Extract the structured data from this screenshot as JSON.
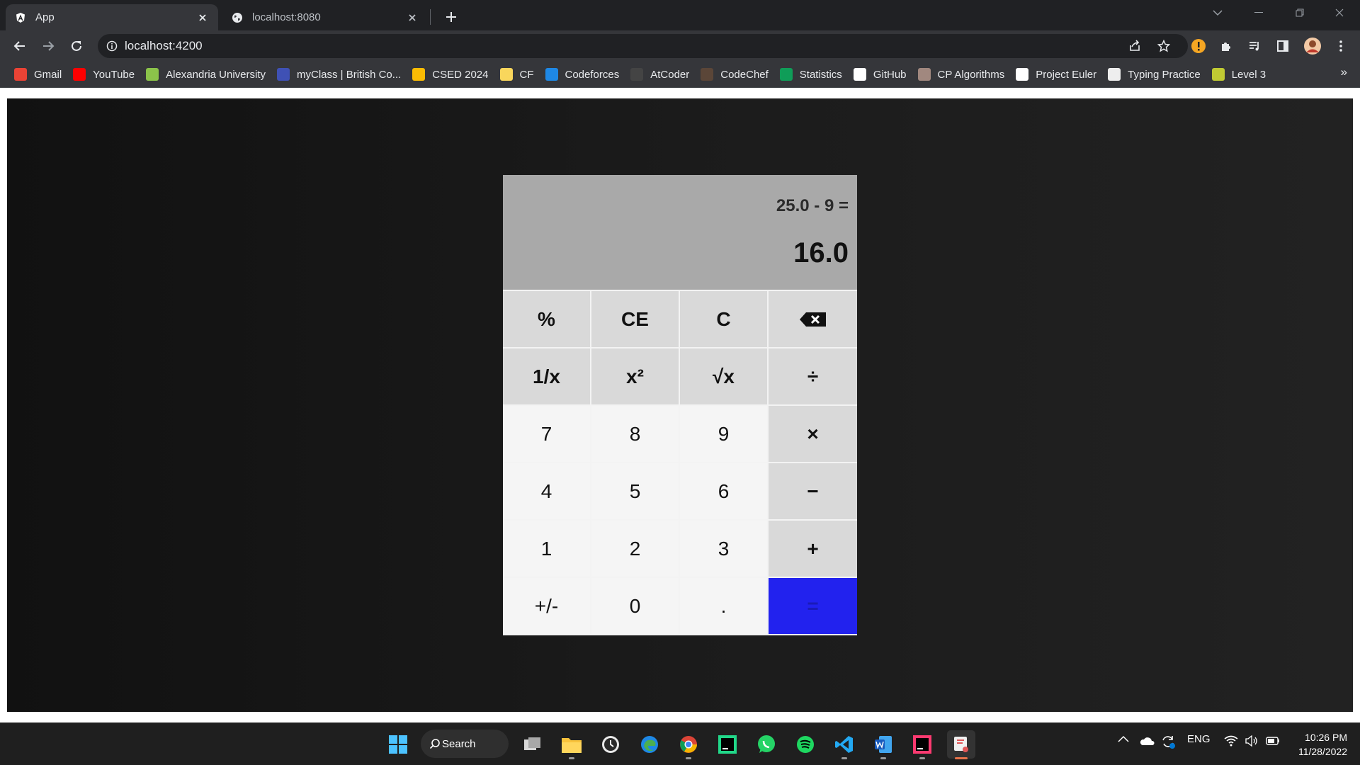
{
  "browser": {
    "tabs": [
      {
        "title": "App",
        "active": true,
        "icon": "angular-icon"
      },
      {
        "title": "localhost:8080",
        "active": false,
        "icon": "globe-icon"
      }
    ],
    "address": "localhost:4200"
  },
  "bookmarks": [
    {
      "label": "Gmail",
      "icon": "gmail-icon",
      "color": "#ea4335"
    },
    {
      "label": "YouTube",
      "icon": "youtube-icon",
      "color": "#ff0000"
    },
    {
      "label": "Alexandria University",
      "icon": "alexu-icon",
      "color": "#8bc34a"
    },
    {
      "label": "myClass | British Co...",
      "icon": "myclass-icon",
      "color": "#3f51b5"
    },
    {
      "label": "CSED 2024",
      "icon": "drive-icon",
      "color": "#fbbc04"
    },
    {
      "label": "CF",
      "icon": "folder-icon",
      "color": "#f9d65c"
    },
    {
      "label": "Codeforces",
      "icon": "codeforces-icon",
      "color": "#1e88e5"
    },
    {
      "label": "AtCoder",
      "icon": "atcoder-icon",
      "color": "#444444"
    },
    {
      "label": "CodeChef",
      "icon": "codechef-icon",
      "color": "#5b4638"
    },
    {
      "label": "Statistics",
      "icon": "statistics-icon",
      "color": "#0f9d58"
    },
    {
      "label": "GitHub",
      "icon": "github-icon",
      "color": "#ffffff"
    },
    {
      "label": "CP Algorithms",
      "icon": "cp-algorithms-icon",
      "color": "#a1887f"
    },
    {
      "label": "Project Euler",
      "icon": "project-euler-icon",
      "color": "#ffffff"
    },
    {
      "label": "Typing Practice",
      "icon": "typing-icon",
      "color": "#eeeeee"
    },
    {
      "label": "Level 3",
      "icon": "level-icon",
      "color": "#c0ca33"
    }
  ],
  "bookmarks_more": "»",
  "calculator": {
    "expression": "25.0 - 9 =",
    "result": "16.0",
    "keys": [
      {
        "label": "%",
        "kind": "fn",
        "name": "percent-key"
      },
      {
        "label": "CE",
        "kind": "fn",
        "name": "clear-entry-key"
      },
      {
        "label": "C",
        "kind": "fn",
        "name": "clear-key"
      },
      {
        "label": "",
        "kind": "fn",
        "name": "backspace-key",
        "icon": "backspace-icon"
      },
      {
        "label": "1/x",
        "kind": "fn",
        "name": "reciprocal-key"
      },
      {
        "label": "x²",
        "kind": "fn",
        "name": "square-key"
      },
      {
        "label": "√x",
        "kind": "fn",
        "name": "sqrt-key"
      },
      {
        "label": "÷",
        "kind": "op",
        "name": "divide-key"
      },
      {
        "label": "7",
        "kind": "num",
        "name": "digit-7-key"
      },
      {
        "label": "8",
        "kind": "num",
        "name": "digit-8-key"
      },
      {
        "label": "9",
        "kind": "num",
        "name": "digit-9-key"
      },
      {
        "label": "×",
        "kind": "op",
        "name": "multiply-key"
      },
      {
        "label": "4",
        "kind": "num",
        "name": "digit-4-key"
      },
      {
        "label": "5",
        "kind": "num",
        "name": "digit-5-key"
      },
      {
        "label": "6",
        "kind": "num",
        "name": "digit-6-key"
      },
      {
        "label": "−",
        "kind": "op",
        "name": "subtract-key"
      },
      {
        "label": "1",
        "kind": "num",
        "name": "digit-1-key"
      },
      {
        "label": "2",
        "kind": "num",
        "name": "digit-2-key"
      },
      {
        "label": "3",
        "kind": "num",
        "name": "digit-3-key"
      },
      {
        "label": "+",
        "kind": "op",
        "name": "add-key"
      },
      {
        "label": "+/-",
        "kind": "num",
        "name": "negate-key"
      },
      {
        "label": "0",
        "kind": "num",
        "name": "digit-0-key"
      },
      {
        "label": ".",
        "kind": "num",
        "name": "decimal-key"
      },
      {
        "label": "=",
        "kind": "eq",
        "name": "equals-key"
      }
    ],
    "colors": {
      "display": "#a9a9a9",
      "equals": "#2222ee",
      "fn_key": "#d9d9d9",
      "num_key": "#f5f5f5"
    }
  },
  "taskbar": {
    "search_label": "Search",
    "language": "ENG",
    "time": "10:26 PM",
    "date": "11/28/2022"
  }
}
